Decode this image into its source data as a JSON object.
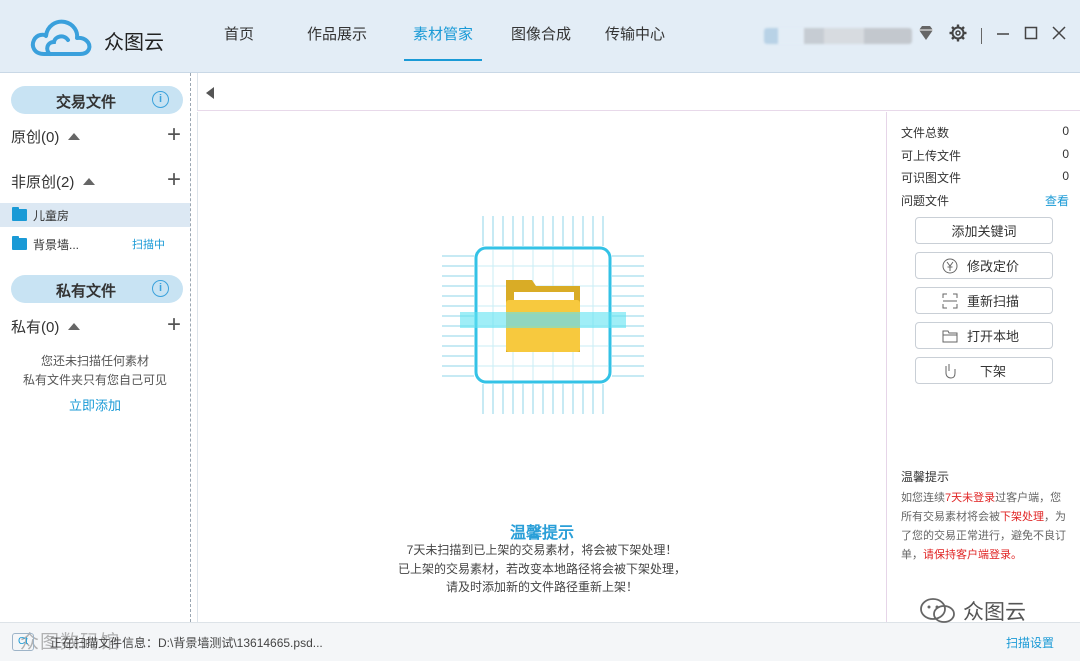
{
  "header": {
    "app_name": "众图云",
    "nav": [
      {
        "label": "首页",
        "active": false
      },
      {
        "label": "作品展示",
        "active": false
      },
      {
        "label": "素材管家",
        "active": true
      },
      {
        "label": "图像合成",
        "active": false
      },
      {
        "label": "传输中心",
        "active": false
      }
    ],
    "accent_color": "#1a9ad6",
    "icons": [
      "diamond-icon",
      "gear-icon",
      "minimize-icon",
      "maximize-icon",
      "close-icon"
    ]
  },
  "sidebar": {
    "trade_section": {
      "title": "交易文件",
      "info": "i"
    },
    "original": {
      "label": "原创(0)"
    },
    "non_original": {
      "label": "非原创(2)"
    },
    "folders": [
      {
        "name": "儿童房",
        "status": "",
        "selected": true
      },
      {
        "name": "背景墙...",
        "status": "扫描中",
        "selected": false
      }
    ],
    "private_section": {
      "title": "私有文件",
      "info": "i"
    },
    "private": {
      "label": "私有(0)"
    },
    "empty_line1": "您还未扫描任何素材",
    "empty_line2": "私有文件夹只有您自己可见",
    "add_link": "立即添加"
  },
  "main": {
    "tip_title": "温馨提示",
    "tip_lines": [
      "7天未扫描到已上架的交易素材，将会被下架处理！",
      "已上架的交易素材，若改变本地路径将会被下架处理，",
      "请及时添加新的文件路径重新上架！"
    ]
  },
  "right_panel": {
    "stats": [
      {
        "label": "文件总数",
        "value": "0"
      },
      {
        "label": "可上传文件",
        "value": "0"
      },
      {
        "label": "可识图文件",
        "value": "0"
      }
    ],
    "problem": {
      "label": "问题文件",
      "link": "查看"
    },
    "buttons": [
      {
        "label": "添加关键词",
        "icon": ""
      },
      {
        "label": "修改定价",
        "icon": "yen-icon"
      },
      {
        "label": "重新扫描",
        "icon": "scan-icon"
      },
      {
        "label": "打开本地",
        "icon": "folder-icon"
      },
      {
        "label": "下架",
        "icon": "hand-icon"
      }
    ],
    "tip_title": "温馨提示",
    "tip_p1": "如您连续",
    "tip_r1": "7天未登录",
    "tip_p2": "过客户端，您所有交易素材将会被",
    "tip_r2": "下架处理",
    "tip_p3": "，为了您的交易正常进行，避免不良订单，",
    "tip_r3": "请保持客户端登录。"
  },
  "statusbar": {
    "badge": "Ct",
    "text": "正在扫描文件信息：D:\\背景墙测试\\13614665.psd...",
    "scan_settings": "扫描设置"
  },
  "watermarks": {
    "left": "众图数码馆",
    "right": "众图云"
  }
}
